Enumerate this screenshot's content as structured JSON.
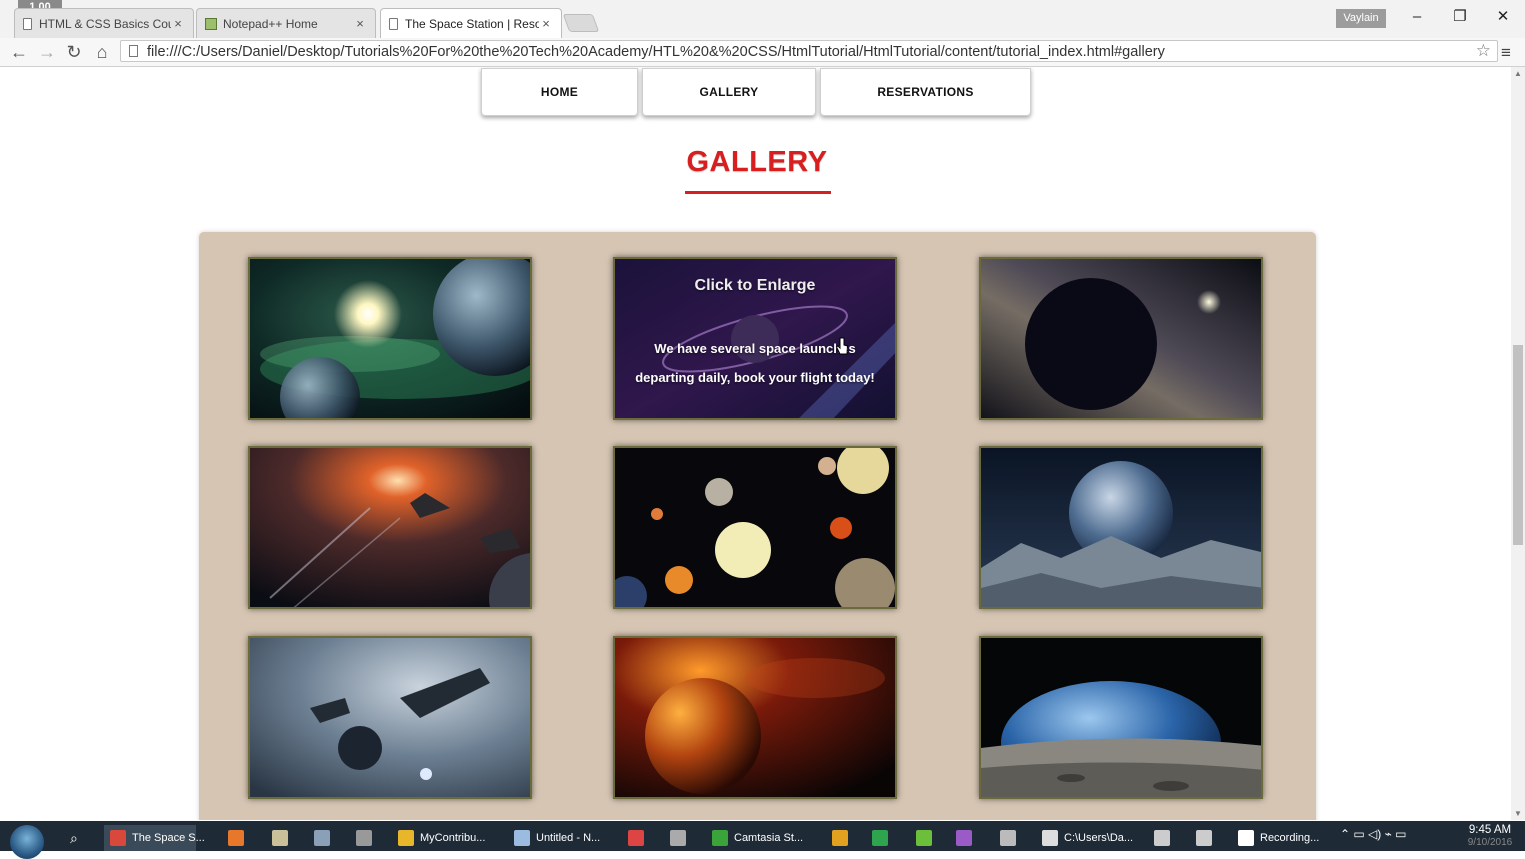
{
  "recording_badge": "1.00",
  "browser": {
    "tabs": [
      {
        "title": "HTML & CSS Basics Cours",
        "close": "×"
      },
      {
        "title": "Notepad++ Home",
        "close": "×"
      },
      {
        "title": "The Space Station | Resort",
        "close": "×"
      }
    ],
    "profile": "Vaylain",
    "window_controls": {
      "minimize": "–",
      "restore": "❐",
      "close": "✕"
    },
    "address": "file:///C:/Users/Daniel/Desktop/Tutorials%20For%20the%20Tech%20Academy/HTL%20&%20CSS/HtmlTutorial/HtmlTutorial/content/tutorial_index.html#gallery",
    "nav_icons": {
      "back": "←",
      "forward": "→",
      "reload": "↻",
      "home": "⌂",
      "star": "☆",
      "menu": "≡"
    }
  },
  "site_nav": [
    {
      "label": "HOME"
    },
    {
      "label": "GALLERY"
    },
    {
      "label": "RESERVATIONS"
    }
  ],
  "gallery": {
    "title": "GALLERY",
    "hover_overlay": {
      "title": "Click to Enlarge",
      "line1": "We have several space launches",
      "line2": "departing daily, book your flight today!"
    },
    "images": [
      {
        "name": "green-nebula-planets"
      },
      {
        "name": "purple-ringed-planet"
      },
      {
        "name": "dark-planet-milky-way"
      },
      {
        "name": "space-battle-explosion"
      },
      {
        "name": "solar-system-planets"
      },
      {
        "name": "blue-planet-over-rocky-moon"
      },
      {
        "name": "spaceships-cloudy-sky"
      },
      {
        "name": "burning-orange-planet"
      },
      {
        "name": "earth-rising-over-moon"
      }
    ]
  },
  "taskbar": {
    "items": [
      {
        "label": "The Space S...",
        "color": "#d9493b"
      },
      {
        "label": "",
        "color": "#e7772a"
      },
      {
        "label": "",
        "color": "#c9c09a"
      },
      {
        "label": "",
        "color": "#8aa0b6"
      },
      {
        "label": "",
        "color": "#999999"
      },
      {
        "label": "MyContribu...",
        "color": "#e8b62a"
      },
      {
        "label": "Untitled - N...",
        "color": "#9bbbe0"
      },
      {
        "label": "",
        "color": "#d44"
      },
      {
        "label": "",
        "color": "#aaa"
      },
      {
        "label": "Camtasia St...",
        "color": "#3aa33a"
      },
      {
        "label": "",
        "color": "#e2a11f"
      },
      {
        "label": "",
        "color": "#2ea44f"
      },
      {
        "label": "",
        "color": "#6bbf3a"
      },
      {
        "label": "",
        "color": "#9a5bc6"
      },
      {
        "label": "",
        "color": "#bbb"
      },
      {
        "label": "C:\\Users\\Da...",
        "color": "#ddd"
      },
      {
        "label": "",
        "color": "#ccc"
      },
      {
        "label": "",
        "color": "#ccc"
      },
      {
        "label": "Recording...",
        "color": "#fff"
      }
    ],
    "time": "9:45 AM",
    "date": "9/10/2016"
  }
}
